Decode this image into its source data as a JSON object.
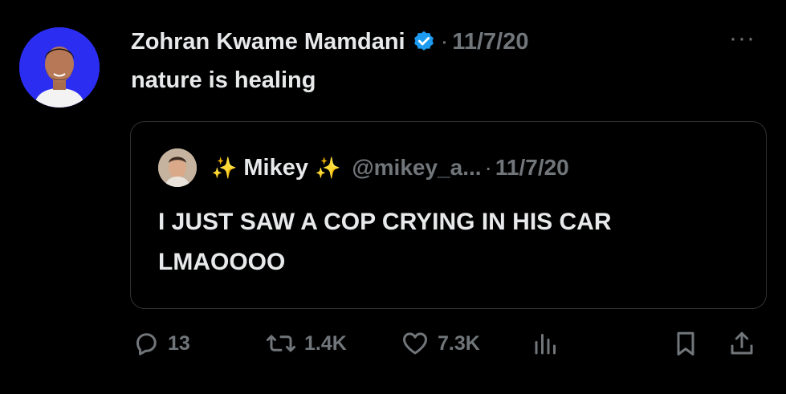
{
  "tweet": {
    "author_name": "Zohran Kwame Mamdani",
    "separator": "·",
    "date": "11/7/20",
    "more_label": "···",
    "text": "nature is healing"
  },
  "quoted": {
    "sparkle_left": "✨",
    "name": "Mikey",
    "sparkle_right": "✨",
    "handle": "@mikey_a...",
    "separator": "·",
    "date": "11/7/20",
    "text": "I JUST SAW A COP CRYING IN HIS CAR LMAOOOO"
  },
  "actions": {
    "replies": "13",
    "reposts": "1.4K",
    "likes": "7.3K"
  },
  "colors": {
    "background": "#000000",
    "text": "#e7e9ea",
    "muted": "#71767b",
    "verified": "#1d9bf0",
    "avatar_bg": "#2b2df0"
  },
  "icons": [
    "verified-badge-icon",
    "more-icon",
    "reply-icon",
    "repost-icon",
    "like-icon",
    "views-icon",
    "bookmark-icon",
    "share-icon"
  ]
}
